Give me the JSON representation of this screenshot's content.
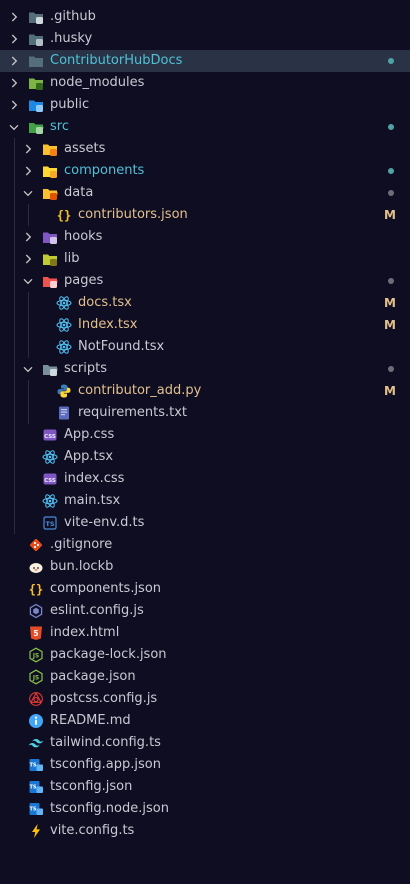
{
  "colors": {
    "background": "#0f0d21",
    "selected_bg": "#2a3346",
    "text_default": "#c9c9d3",
    "text_folder_modified": "#4fc1d6",
    "text_modified": "#e2c08d",
    "badge_modified": "#e2c08d",
    "dot_teal": "#4fa3a5",
    "dot_gray": "#6e6e7a"
  },
  "explorer": {
    "items": [
      {
        "label": ".github",
        "depth": 0,
        "type": "folder",
        "open": false,
        "icon": "github-folder-icon"
      },
      {
        "label": ".husky",
        "depth": 0,
        "type": "folder",
        "open": false,
        "icon": "husky-folder-icon"
      },
      {
        "label": "ContributorHubDocs",
        "depth": 0,
        "type": "folder",
        "open": false,
        "icon": "folder-icon",
        "status": "dot",
        "selected": true
      },
      {
        "label": "node_modules",
        "depth": 0,
        "type": "folder",
        "open": false,
        "icon": "node-folder-icon"
      },
      {
        "label": "public",
        "depth": 0,
        "type": "folder",
        "open": false,
        "icon": "public-folder-icon"
      },
      {
        "label": "src",
        "depth": 0,
        "type": "folder",
        "open": true,
        "icon": "src-folder-icon",
        "status": "dot"
      },
      {
        "label": "assets",
        "depth": 1,
        "type": "folder",
        "open": false,
        "icon": "assets-folder-icon"
      },
      {
        "label": "components",
        "depth": 1,
        "type": "folder",
        "open": false,
        "icon": "components-folder-icon",
        "status": "dot"
      },
      {
        "label": "data",
        "depth": 1,
        "type": "folder",
        "open": true,
        "icon": "data-folder-icon",
        "status": "dot-gray"
      },
      {
        "label": "contributors.json",
        "depth": 2,
        "type": "file",
        "icon": "json-icon",
        "status": "M"
      },
      {
        "label": "hooks",
        "depth": 1,
        "type": "folder",
        "open": false,
        "icon": "hooks-folder-icon"
      },
      {
        "label": "lib",
        "depth": 1,
        "type": "folder",
        "open": false,
        "icon": "lib-folder-icon"
      },
      {
        "label": "pages",
        "depth": 1,
        "type": "folder",
        "open": true,
        "icon": "pages-folder-icon",
        "status": "dot-gray"
      },
      {
        "label": "docs.tsx",
        "depth": 2,
        "type": "file",
        "icon": "react-icon",
        "status": "M"
      },
      {
        "label": "Index.tsx",
        "depth": 2,
        "type": "file",
        "icon": "react-icon",
        "status": "M"
      },
      {
        "label": "NotFound.tsx",
        "depth": 2,
        "type": "file",
        "icon": "react-icon"
      },
      {
        "label": "scripts",
        "depth": 1,
        "type": "folder",
        "open": true,
        "icon": "scripts-folder-icon",
        "status": "dot-gray"
      },
      {
        "label": "contributor_add.py",
        "depth": 2,
        "type": "file",
        "icon": "python-icon",
        "status": "M"
      },
      {
        "label": "requirements.txt",
        "depth": 2,
        "type": "file",
        "icon": "requirements-icon"
      },
      {
        "label": "App.css",
        "depth": 1,
        "type": "file",
        "icon": "css-icon"
      },
      {
        "label": "App.tsx",
        "depth": 1,
        "type": "file",
        "icon": "react-icon"
      },
      {
        "label": "index.css",
        "depth": 1,
        "type": "file",
        "icon": "css-icon"
      },
      {
        "label": "main.tsx",
        "depth": 1,
        "type": "file",
        "icon": "react-icon"
      },
      {
        "label": "vite-env.d.ts",
        "depth": 1,
        "type": "file",
        "icon": "ts-icon"
      },
      {
        "label": ".gitignore",
        "depth": 0,
        "type": "file",
        "icon": "git-icon"
      },
      {
        "label": "bun.lockb",
        "depth": 0,
        "type": "file",
        "icon": "bun-icon"
      },
      {
        "label": "components.json",
        "depth": 0,
        "type": "file",
        "icon": "json-icon"
      },
      {
        "label": "eslint.config.js",
        "depth": 0,
        "type": "file",
        "icon": "eslint-icon"
      },
      {
        "label": "index.html",
        "depth": 0,
        "type": "file",
        "icon": "html-icon"
      },
      {
        "label": "package-lock.json",
        "depth": 0,
        "type": "file",
        "icon": "nodejs-icon"
      },
      {
        "label": "package.json",
        "depth": 0,
        "type": "file",
        "icon": "nodejs-icon"
      },
      {
        "label": "postcss.config.js",
        "depth": 0,
        "type": "file",
        "icon": "postcss-icon"
      },
      {
        "label": "README.md",
        "depth": 0,
        "type": "file",
        "icon": "info-icon"
      },
      {
        "label": "tailwind.config.ts",
        "depth": 0,
        "type": "file",
        "icon": "tailwind-icon"
      },
      {
        "label": "tsconfig.app.json",
        "depth": 0,
        "type": "file",
        "icon": "tsconfig-icon"
      },
      {
        "label": "tsconfig.json",
        "depth": 0,
        "type": "file",
        "icon": "tsconfig-icon"
      },
      {
        "label": "tsconfig.node.json",
        "depth": 0,
        "type": "file",
        "icon": "tsconfig-icon"
      },
      {
        "label": "vite.config.ts",
        "depth": 0,
        "type": "file",
        "icon": "vite-icon"
      }
    ]
  }
}
